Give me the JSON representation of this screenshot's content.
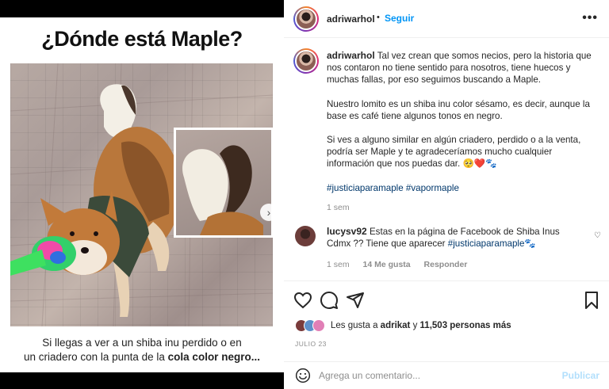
{
  "media": {
    "title": "¿Dónde está Maple?",
    "caption_line1": "Si llegas a ver a un shiba inu perdido o en",
    "caption_line2": "un criadero con la punta de la",
    "caption_bold": "cola color negro..."
  },
  "header": {
    "username": "adriwarhol",
    "separator": "•",
    "follow_label": "Seguir",
    "more_icon": "more-options-icon"
  },
  "post": {
    "username": "adriwarhol",
    "paragraph1": "Tal vez crean que somos necios, pero la historia que nos contaron no tiene sentido para nosotros, tiene huecos y muchas fallas, por eso seguimos buscando a Maple.",
    "paragraph2": "Nuestro lomito es un shiba inu color sésamo, es decir, aunque la base es café tiene algunos tonos en negro.",
    "paragraph3": "Si ves a alguno similar en algún criadero, perdido o a la venta, podría ser Maple y te agradeceríamos mucho cualquier información que nos puedas dar. 🥺❤️🐾",
    "hashtag1": "#justiciaparamaple",
    "hashtag2": "#vapormaple",
    "time": "1 sem"
  },
  "comment": {
    "username": "lucysv92",
    "text": "Estas en la página de Facebook de Shiba Inus Cdmx ?? Tiene que aparecer",
    "hashtag": "#justiciaparamaple🐾",
    "time": "1 sem",
    "likes": "14 Me gusta",
    "reply_label": "Responder"
  },
  "likes": {
    "prefix": "Les gusta a",
    "user": "adrikat",
    "connector": "y",
    "count": "11,503 personas más"
  },
  "date": "JULIO 23",
  "add_comment": {
    "placeholder": "Agrega un comentario...",
    "publish_label": "Publicar"
  },
  "colors": {
    "link_blue": "#0095f6",
    "hashtag": "#00376b",
    "muted": "#8e8e8e",
    "publish_disabled": "#b2dffc"
  }
}
